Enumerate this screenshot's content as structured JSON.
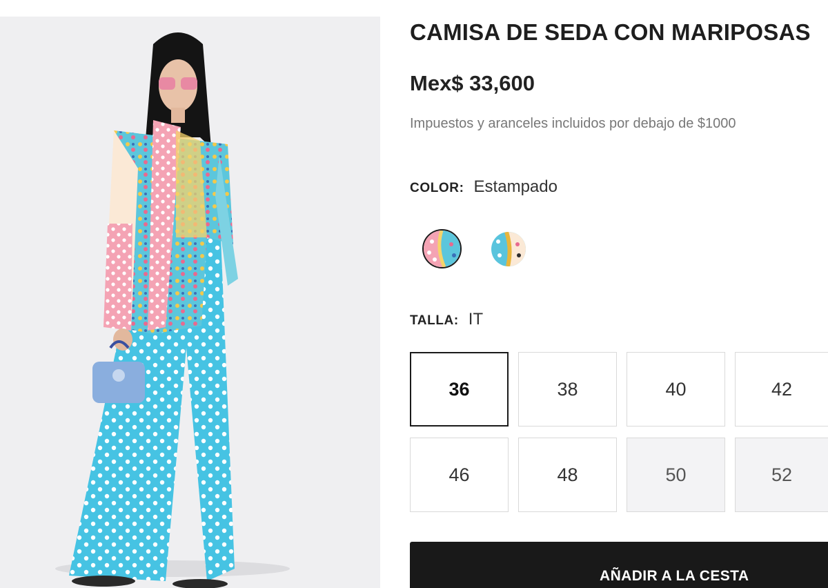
{
  "product": {
    "title": "CAMISA DE SEDA CON MARIPOSAS",
    "price": "Mex$ 33,600",
    "tax_note": "Impuestos y aranceles incluidos por debajo de $1000"
  },
  "color": {
    "label": "COLOR:",
    "value": "Estampado",
    "swatches": [
      {
        "icon": "pink-print-swatch",
        "selected": true
      },
      {
        "icon": "blue-print-swatch",
        "selected": false
      }
    ]
  },
  "size": {
    "label": "TALLA:",
    "system": "IT",
    "options": [
      {
        "label": "36",
        "selected": true,
        "available": true
      },
      {
        "label": "38",
        "selected": false,
        "available": true
      },
      {
        "label": "40",
        "selected": false,
        "available": true
      },
      {
        "label": "42",
        "selected": false,
        "available": true
      },
      {
        "label": "46",
        "selected": false,
        "available": true
      },
      {
        "label": "48",
        "selected": false,
        "available": true
      },
      {
        "label": "50",
        "selected": false,
        "available": false
      },
      {
        "label": "52",
        "selected": false,
        "available": false
      }
    ]
  },
  "cart": {
    "button_label": "AÑADIR A LA CESTA"
  },
  "colors": {
    "accent": "#191919",
    "text_muted": "#777777",
    "photo_bg": "#efeff1"
  }
}
